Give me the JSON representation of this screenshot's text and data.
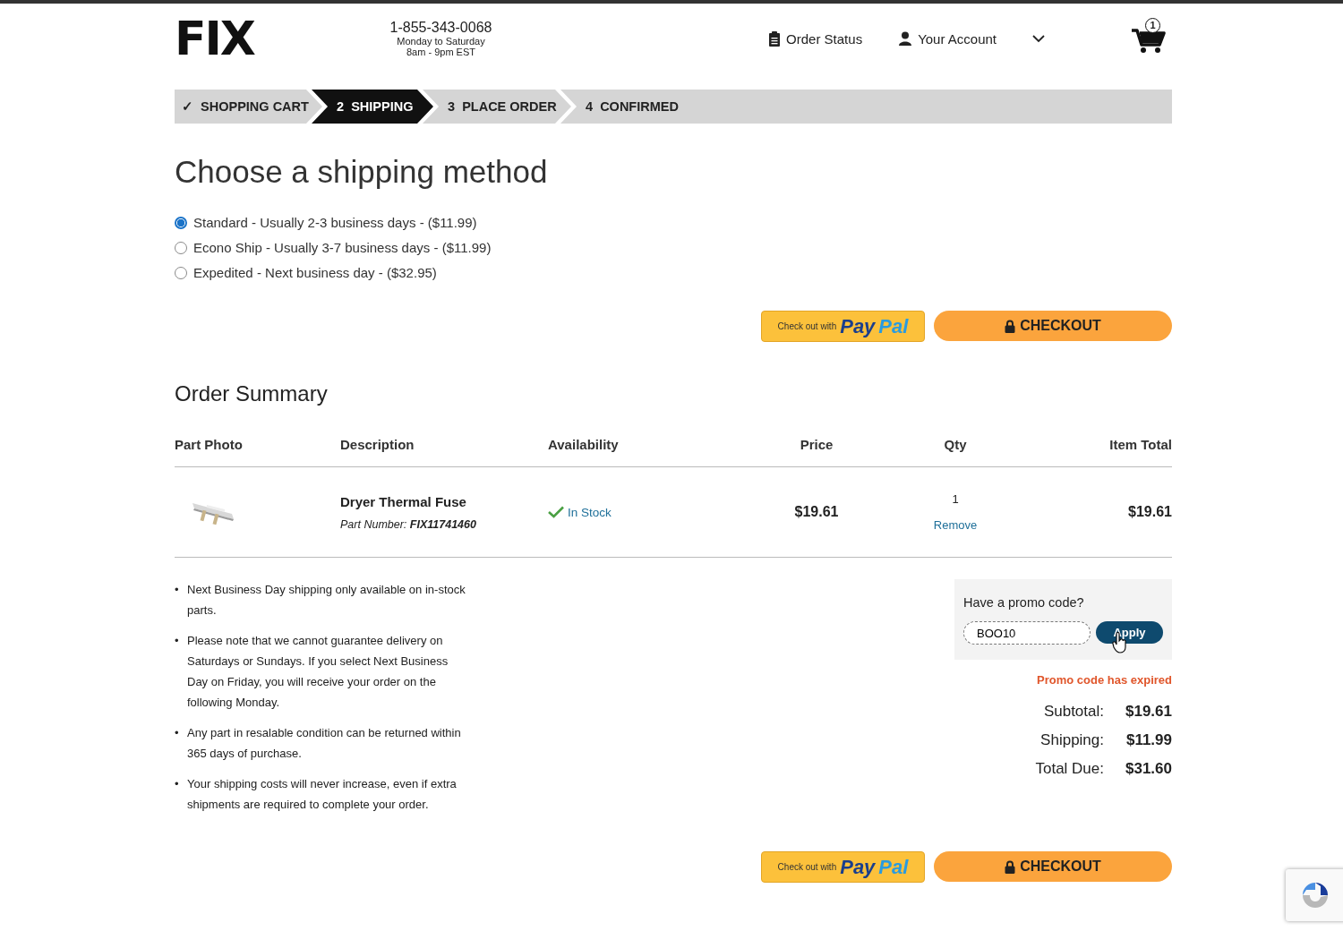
{
  "header": {
    "logo": "FIX",
    "phone": "1-855-343-0068",
    "hours": [
      "Monday to Saturday",
      "8am - 9pm EST"
    ],
    "order_status": "Order Status",
    "account": "Your Account",
    "cart_count": "1"
  },
  "steps": [
    {
      "number": "✓",
      "label": "SHOPPING CART",
      "selected": false
    },
    {
      "number": "2",
      "label": "SHIPPING",
      "selected": true
    },
    {
      "number": "3",
      "label": "PLACE ORDER",
      "selected": false
    },
    {
      "number": "4",
      "label": "CONFIRMED",
      "selected": false
    }
  ],
  "heading": "Choose a shipping method",
  "shipping_options": [
    {
      "label": "Standard - Usually 2-3 business days - ($11.99)",
      "selected": true
    },
    {
      "label": "Econo Ship - Usually 3-7 business days - ($11.99)",
      "selected": false
    },
    {
      "label": "Expedited - Next business day - ($32.95)",
      "selected": false
    }
  ],
  "checkout_bars": [
    {
      "paypal_prefix": "Check out with",
      "paypal_dark": "Pay",
      "paypal_light": "Pal",
      "checkout": "CHECKOUT"
    },
    {
      "paypal_prefix": "Check out with",
      "paypal_dark": "Pay",
      "paypal_light": "Pal",
      "checkout": "CHECKOUT"
    }
  ],
  "order_summary": {
    "title": "Order Summary",
    "columns": [
      "Part Photo",
      "Description",
      "Availability",
      "Price",
      "Qty",
      "Item Total"
    ],
    "rows": [
      {
        "name": "Dryer Thermal Fuse",
        "part_label": "Part Number:",
        "part_number": "FIX11741460",
        "availability": "In Stock",
        "price": "$19.61",
        "qty": "1",
        "remove": "Remove",
        "total": "$19.61"
      }
    ]
  },
  "notes": [
    {
      "bullet": "•",
      "text": "Next Business Day shipping only available on in-stock parts."
    },
    {
      "bullet": "•",
      "text": "Please note that we cannot guarantee delivery on Saturdays or Sundays. If you select Next Business Day on Friday, you will receive your order on the following Monday."
    },
    {
      "bullet": "•",
      "text": "Any part in resalable condition can be returned within 365 days of purchase."
    },
    {
      "bullet": "•",
      "text": "Your shipping costs will never increase, even if extra shipments are required to complete your order."
    }
  ],
  "promo": {
    "prompt": "Have a promo code?",
    "value": "BOO10",
    "button": "Apply",
    "error": "Promo code has expired"
  },
  "totals": [
    {
      "label": "Subtotal:",
      "value": "$19.61"
    },
    {
      "label": "Shipping:",
      "value": "$11.99"
    },
    {
      "label": "Total Due:",
      "value": "$31.60"
    }
  ]
}
